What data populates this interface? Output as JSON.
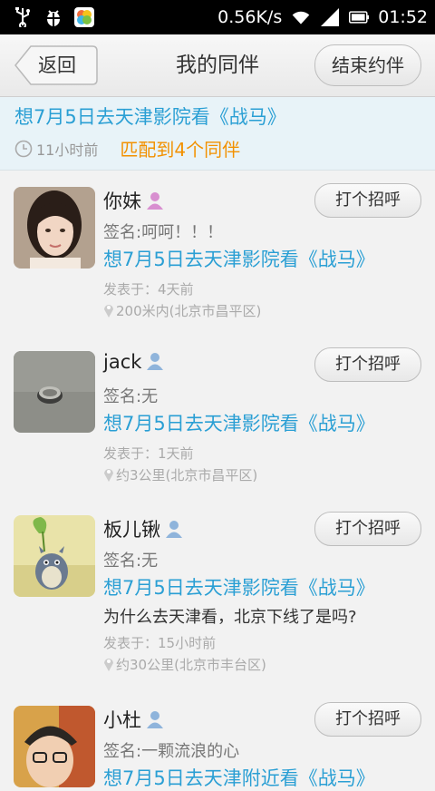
{
  "status": {
    "speed": "0.56K/s",
    "time": "01:52"
  },
  "header": {
    "back_label": "返回",
    "title": "我的同伴",
    "end_label": "结束约伴"
  },
  "summary": {
    "title": "想7月5日去天津影院看《战马》",
    "time_ago": "11小时前",
    "match_text": "匹配到4个同伴"
  },
  "hello_label": "打个招呼",
  "companions": [
    {
      "name": "你妹",
      "gender": "female",
      "sign": "签名:呵呵！！！",
      "post": "想7月5日去天津影院看《战马》",
      "reply": "",
      "posted": "发表于：4天前",
      "distance": "200米内(北京市昌平区)"
    },
    {
      "name": "jack",
      "gender": "male",
      "sign": "签名:无",
      "post": "想7月5日去天津影院看《战马》",
      "reply": "",
      "posted": "发表于：1天前",
      "distance": "约3公里(北京市昌平区)"
    },
    {
      "name": "板儿锹",
      "gender": "male",
      "sign": "签名:无",
      "post": "想7月5日去天津影院看《战马》",
      "reply": "为什么去天津看，北京下线了是吗?",
      "posted": "发表于：15小时前",
      "distance": "约30公里(北京市丰台区)"
    },
    {
      "name": "小杜",
      "gender": "male",
      "sign": "签名:一颗流浪的心",
      "post": "想7月5日去天津附近看《战马》",
      "reply": "",
      "posted": "",
      "distance": ""
    }
  ],
  "colors": {
    "accent": "#2a9fd4",
    "match": "#f29100",
    "female_icon": "#d88fd0",
    "male_icon": "#8fb4db"
  }
}
